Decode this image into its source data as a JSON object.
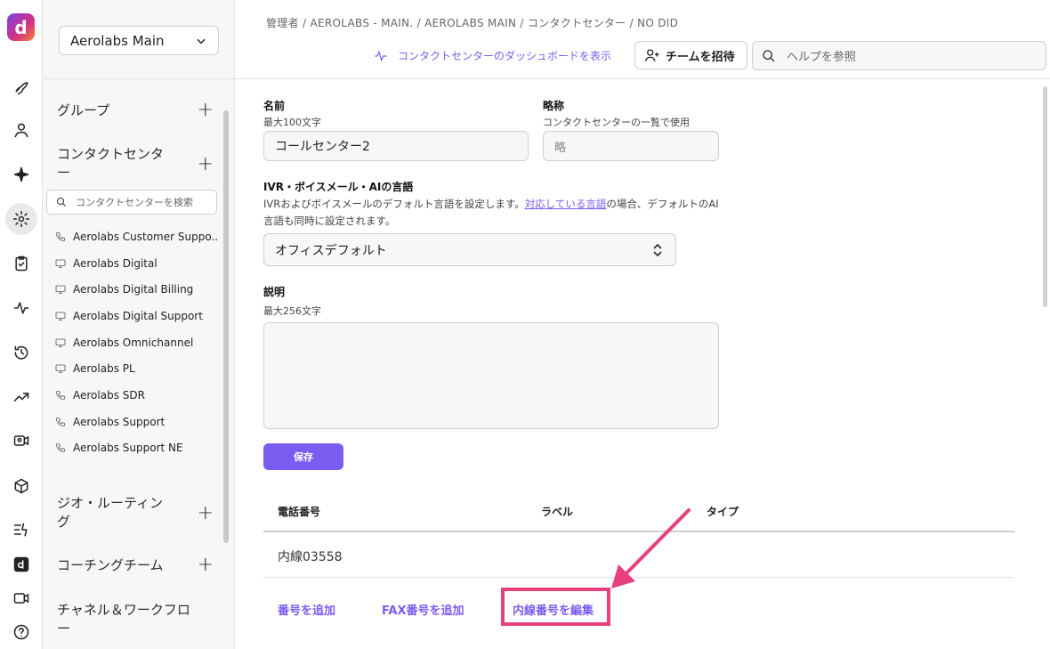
{
  "rail": {
    "logo_letter": "d",
    "icons": [
      "rocket-icon",
      "user-icon",
      "sparkle-icon",
      "gear-icon",
      "clipboard-icon",
      "activity-icon",
      "history-icon",
      "trending-icon",
      "video-person-icon",
      "cube-icon",
      "flow-icon",
      "dialpad-logo-icon",
      "video-icon",
      "help-icon"
    ]
  },
  "sidebar": {
    "workspace": "Aerolabs Main",
    "groups_label": "グループ",
    "contact_centers_label": "コンタクトセンター",
    "search_placeholder": "コンタクトセンターを検索",
    "contact_centers": [
      {
        "name": "Aerolabs Customer Suppo...",
        "icon": "phone-icon"
      },
      {
        "name": "Aerolabs Digital",
        "icon": "monitor-icon"
      },
      {
        "name": "Aerolabs Digital Billing",
        "icon": "monitor-icon"
      },
      {
        "name": "Aerolabs Digital Support",
        "icon": "monitor-icon"
      },
      {
        "name": "Aerolabs Omnichannel",
        "icon": "monitor-icon"
      },
      {
        "name": "Aerolabs PL",
        "icon": "monitor-icon"
      },
      {
        "name": "Aerolabs SDR",
        "icon": "phone-icon"
      },
      {
        "name": "Aerolabs Support",
        "icon": "phone-icon"
      },
      {
        "name": "Aerolabs Support NE",
        "icon": "phone-icon"
      }
    ],
    "geo_routing_label": "ジオ・ルーティング",
    "coaching_label": "コーチングチーム",
    "channels_label": "チャネル＆ワークフロー"
  },
  "header": {
    "breadcrumb": "管理者 / AEROLABS - MAIN. / AEROLABS MAIN / コンタクトセンター / NO DID",
    "dashboard_link": "コンタクトセンターのダッシュボードを表示",
    "invite_button": "チームを招待",
    "help_placeholder": "ヘルプを参照"
  },
  "form": {
    "name_label": "名前",
    "name_hint": "最大100文字",
    "name_value": "コールセンター2",
    "abbr_label": "略称",
    "abbr_hint": "コンタクトセンターの一覧で使用",
    "abbr_placeholder": "略",
    "lang_label": "IVR・ボイスメール・AIの言語",
    "lang_desc_1": "IVRおよびボイスメールのデフォルト言語を設定します。",
    "lang_desc_link": "対応している言語",
    "lang_desc_2": "の場合、デフォルトのAI言語も同時に設定されます。",
    "lang_value": "オフィスデフォルト",
    "desc_label": "説明",
    "desc_hint": "最大256文字",
    "save_button": "保存"
  },
  "table": {
    "headers": [
      "電話番号",
      "ラベル",
      "タイプ"
    ],
    "rows": [
      [
        "内線03558",
        "",
        ""
      ]
    ],
    "actions": {
      "add_number": "番号を追加",
      "add_fax": "FAX番号を追加",
      "edit_extension": "内線番号を編集"
    }
  },
  "colors": {
    "accent": "#7a5cf0",
    "highlight": "#e8407e"
  }
}
